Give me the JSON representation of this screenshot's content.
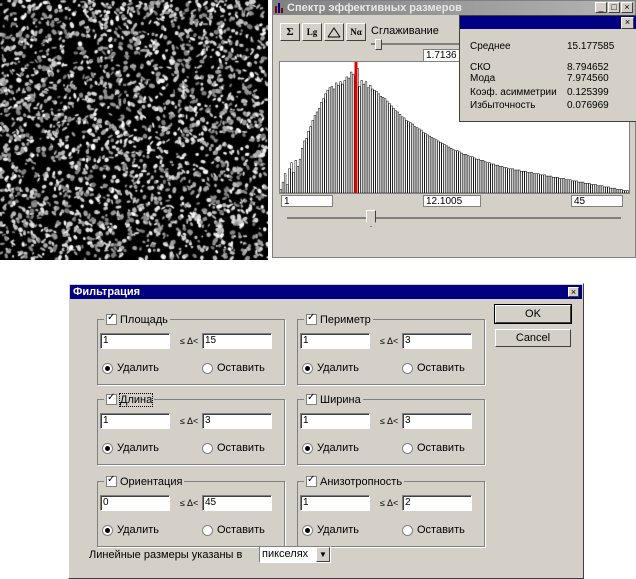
{
  "histogram_window": {
    "title": "Спектр эффективных размеров",
    "toolbar": {
      "sigma": "Σ",
      "lg": "Lg",
      "nalpha": "Nα"
    },
    "smoothing_label": "Сглаживание",
    "smoothing_value": "1.7136",
    "min_value": "1",
    "current_value": "12.1005",
    "max_value": "45",
    "controls": {
      "minimize": "_",
      "maximize": "□",
      "close": "×"
    }
  },
  "stats": {
    "close": "×",
    "rows": [
      {
        "label": "Среднее",
        "value": "15.177585"
      },
      {
        "label": "СКО",
        "value": "8.794652"
      },
      {
        "label": "Мода",
        "value": "7.974560"
      },
      {
        "label": "Коэф. асимметрии",
        "value": "0.125399"
      },
      {
        "label": "Избыточность",
        "value": "0.076969"
      }
    ]
  },
  "chart_data": {
    "type": "bar",
    "title": "",
    "xlabel": "",
    "ylabel": "",
    "marker_color": "#e00000",
    "bar_color": "#ffffff",
    "bar_stroke": "#000000",
    "values": [
      3,
      9,
      16,
      7,
      20,
      25,
      17,
      27,
      22,
      28,
      37,
      43,
      45,
      51,
      55,
      60,
      64,
      67,
      70,
      75,
      78,
      82,
      85,
      87,
      88,
      86,
      91,
      89,
      92,
      90,
      93,
      96,
      95,
      100,
      98,
      96,
      103,
      88,
      93,
      90,
      92,
      87,
      89,
      86,
      85,
      84,
      82,
      80,
      79,
      78,
      76,
      74,
      72,
      70,
      68,
      67,
      65,
      63,
      62,
      60,
      59,
      58,
      57,
      55,
      54,
      53,
      52,
      50,
      49,
      48,
      47,
      46,
      45,
      44,
      43,
      42,
      41,
      40,
      39,
      38,
      37,
      36,
      35,
      35,
      34,
      33,
      32,
      32,
      31,
      30,
      30,
      29,
      28,
      28,
      27,
      27,
      26,
      25,
      25,
      24,
      24,
      23,
      23,
      22,
      22,
      21,
      21,
      20,
      20,
      20,
      19,
      19,
      19,
      18,
      18,
      18,
      17,
      17,
      17,
      16,
      16,
      16,
      15,
      15,
      15,
      14,
      14,
      14,
      13,
      13,
      13,
      12,
      12,
      12,
      11,
      11,
      11,
      10,
      10,
      10,
      9,
      9,
      9,
      8,
      8,
      8,
      7,
      7,
      7,
      6,
      6,
      6,
      5,
      5,
      5,
      4,
      4,
      4,
      3,
      3,
      3,
      2,
      2,
      2
    ]
  },
  "dialog": {
    "title": "Фильтрация",
    "close": "×",
    "ok_label": "OK",
    "cancel_label": "Cancel",
    "le_label": "≤ Δ<",
    "groups": [
      {
        "title": "Площадь",
        "from": "1",
        "to": "15",
        "delete": "Удалить",
        "keep": "Оставить"
      },
      {
        "title": "Периметр",
        "from": "1",
        "to": "3",
        "delete": "Удалить",
        "keep": "Оставить"
      },
      {
        "title": "Длина",
        "from": "1",
        "to": "3",
        "delete": "Удалить",
        "keep": "Оставить"
      },
      {
        "title": "Ширина",
        "from": "1",
        "to": "3",
        "delete": "Удалить",
        "keep": "Оставить"
      },
      {
        "title": "Ориентация",
        "from": "0",
        "to": "45",
        "delete": "Удалить",
        "keep": "Оставить"
      },
      {
        "title": "Анизотропность",
        "from": "1",
        "to": "2",
        "delete": "Удалить",
        "keep": "Оставить"
      }
    ],
    "units_label": "Линейные размеры указаны в",
    "units_value": "пикселях"
  }
}
